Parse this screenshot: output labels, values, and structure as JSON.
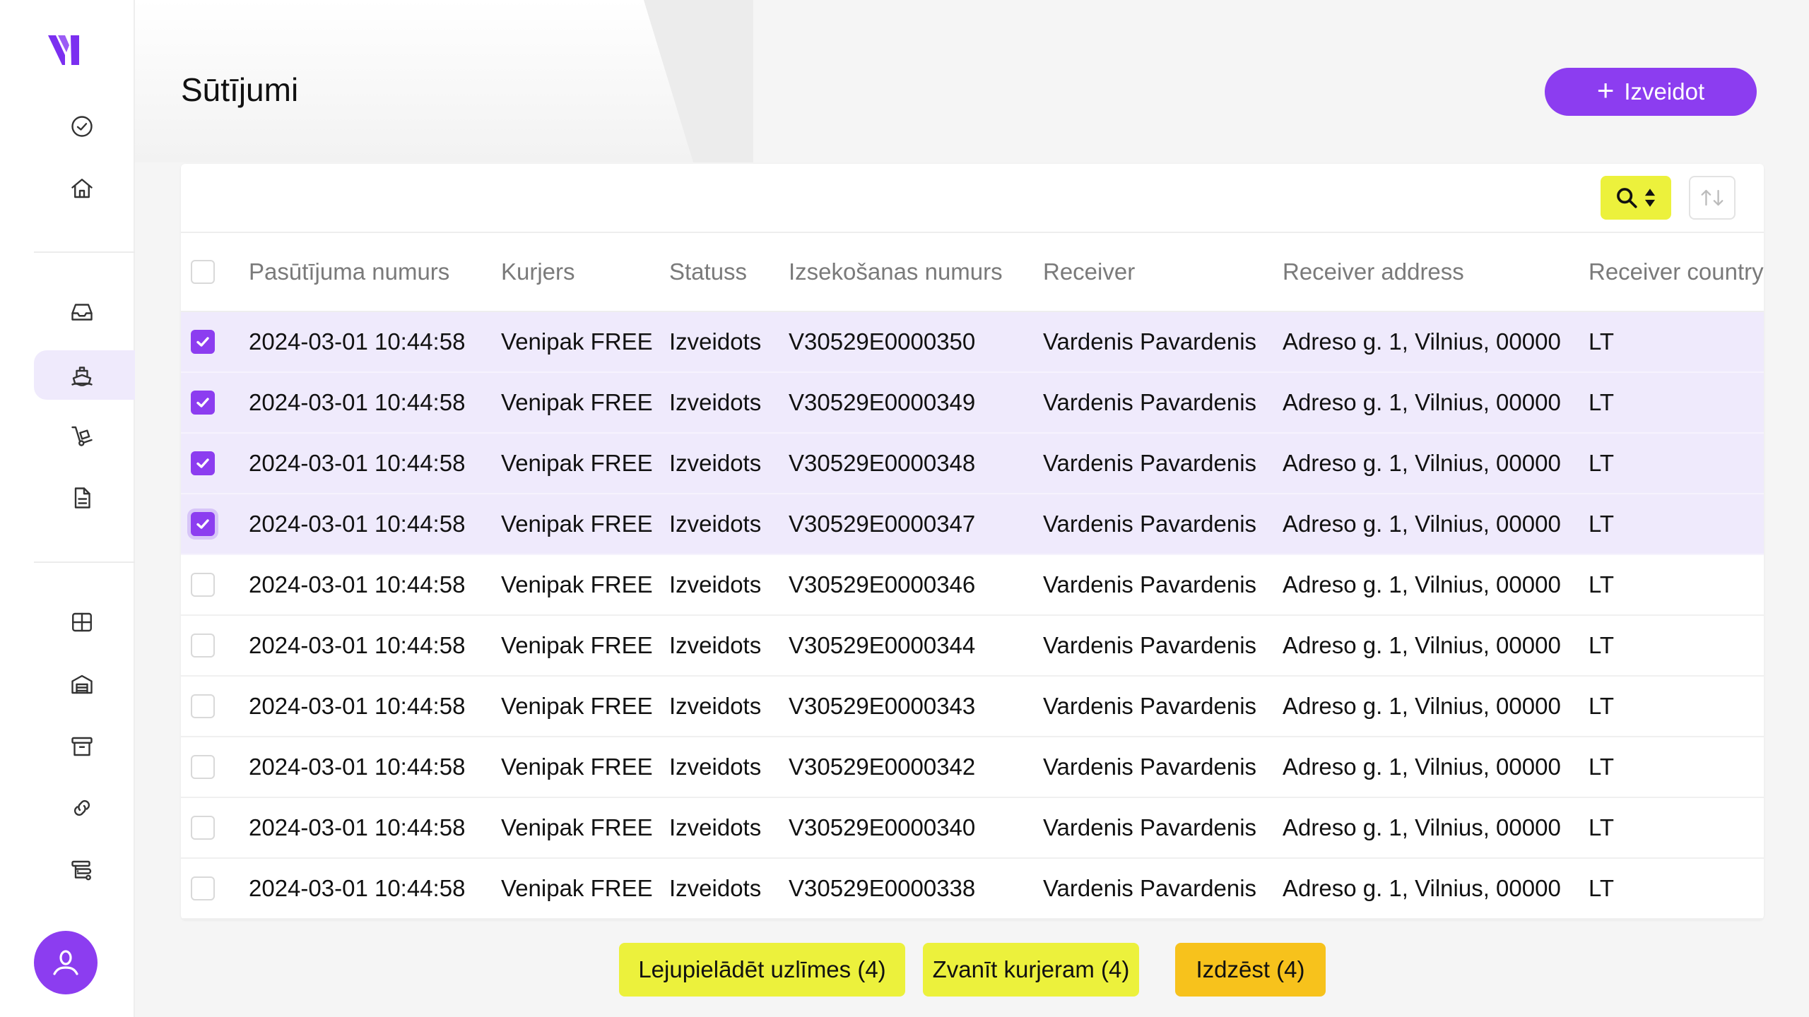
{
  "page": {
    "title": "Sūtījumi",
    "create_label": "Izveidot"
  },
  "sidebar": {
    "items": [
      {
        "icon": "check-circle-icon"
      },
      {
        "icon": "home-icon"
      },
      {
        "icon": "inbox-icon"
      },
      {
        "icon": "ship-icon",
        "active": true
      },
      {
        "icon": "hand-truck-icon"
      },
      {
        "icon": "document-icon"
      },
      {
        "icon": "grid-icon"
      },
      {
        "icon": "warehouse-icon"
      },
      {
        "icon": "archive-icon"
      },
      {
        "icon": "link-icon"
      },
      {
        "icon": "integrations-icon"
      }
    ]
  },
  "table": {
    "columns": [
      "Pasūtījuma numurs",
      "Kurjers",
      "Statuss",
      "Izsekošanas numurs",
      "Receiver",
      "Receiver address",
      "Receiver country"
    ],
    "rows": [
      {
        "selected": true,
        "date": "2024-03-01 10:44:58",
        "courier": "Venipak FREE",
        "status": "Izveidots",
        "tracking": "V30529E0000350",
        "receiver": "Vardenis Pavardenis",
        "address": "Adreso g. 1, Vilnius, 00000",
        "country": "LT"
      },
      {
        "selected": true,
        "date": "2024-03-01 10:44:58",
        "courier": "Venipak FREE",
        "status": "Izveidots",
        "tracking": "V30529E0000349",
        "receiver": "Vardenis Pavardenis",
        "address": "Adreso g. 1, Vilnius, 00000",
        "country": "LT"
      },
      {
        "selected": true,
        "date": "2024-03-01 10:44:58",
        "courier": "Venipak FREE",
        "status": "Izveidots",
        "tracking": "V30529E0000348",
        "receiver": "Vardenis Pavardenis",
        "address": "Adreso g. 1, Vilnius, 00000",
        "country": "LT"
      },
      {
        "selected": true,
        "date": "2024-03-01 10:44:58",
        "courier": "Venipak FREE",
        "status": "Izveidots",
        "tracking": "V30529E0000347",
        "receiver": "Vardenis Pavardenis",
        "address": "Adreso g. 1, Vilnius, 00000",
        "country": "LT"
      },
      {
        "selected": false,
        "date": "2024-03-01 10:44:58",
        "courier": "Venipak FREE",
        "status": "Izveidots",
        "tracking": "V30529E0000346",
        "receiver": "Vardenis Pavardenis",
        "address": "Adreso g. 1, Vilnius, 00000",
        "country": "LT"
      },
      {
        "selected": false,
        "date": "2024-03-01 10:44:58",
        "courier": "Venipak FREE",
        "status": "Izveidots",
        "tracking": "V30529E0000344",
        "receiver": "Vardenis Pavardenis",
        "address": "Adreso g. 1, Vilnius, 00000",
        "country": "LT"
      },
      {
        "selected": false,
        "date": "2024-03-01 10:44:58",
        "courier": "Venipak FREE",
        "status": "Izveidots",
        "tracking": "V30529E0000343",
        "receiver": "Vardenis Pavardenis",
        "address": "Adreso g. 1, Vilnius, 00000",
        "country": "LT"
      },
      {
        "selected": false,
        "date": "2024-03-01 10:44:58",
        "courier": "Venipak FREE",
        "status": "Izveidots",
        "tracking": "V30529E0000342",
        "receiver": "Vardenis Pavardenis",
        "address": "Adreso g. 1, Vilnius, 00000",
        "country": "LT"
      },
      {
        "selected": false,
        "date": "2024-03-01 10:44:58",
        "courier": "Venipak FREE",
        "status": "Izveidots",
        "tracking": "V30529E0000340",
        "receiver": "Vardenis Pavardenis",
        "address": "Adreso g. 1, Vilnius, 00000",
        "country": "LT"
      },
      {
        "selected": false,
        "date": "2024-03-01 10:44:58",
        "courier": "Venipak FREE",
        "status": "Izveidots",
        "tracking": "V30529E0000338",
        "receiver": "Vardenis Pavardenis",
        "address": "Adreso g. 1, Vilnius, 00000",
        "country": "LT"
      }
    ]
  },
  "actions": {
    "download_labels": "Lejupielādēt uzlīmes (4)",
    "call_courier": "Zvanīt kurjeram (4)",
    "delete": "Izdzēst (4)"
  },
  "colors": {
    "accent": "#8c3df0",
    "selected_row": "#efeafc",
    "yellow_button": "#ecf13c",
    "delete_button": "#f7c21c"
  }
}
